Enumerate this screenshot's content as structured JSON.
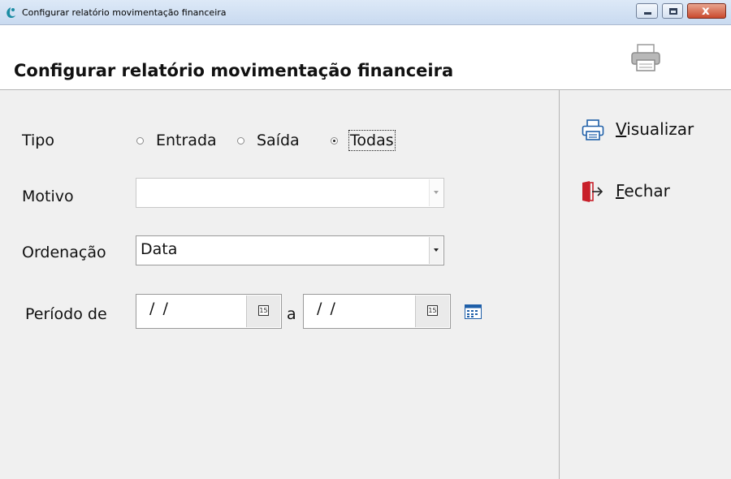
{
  "window": {
    "title": "Configurar relatório movimentação financeira",
    "close_glyph": "x"
  },
  "header": {
    "title": "Configurar relatório movimentação financeira",
    "print_icon": "printer-icon"
  },
  "form": {
    "tipo": {
      "label": "Tipo",
      "options": [
        "Entrada",
        "Saída",
        "Todas"
      ],
      "selected": "Todas"
    },
    "motivo": {
      "label": "Motivo",
      "value": "",
      "enabled": false
    },
    "ordenacao": {
      "label": "Ordenação",
      "value": "Data"
    },
    "periodo": {
      "label": "Período de",
      "separator": "a",
      "start": "/ /",
      "end": "/ /",
      "calendar_btn_text": "15"
    }
  },
  "actions": {
    "visualizar": {
      "label": "isualizar",
      "accel": "V",
      "icon": "printer-icon"
    },
    "fechar": {
      "label": "echar",
      "accel": "F",
      "icon": "exit-door-icon"
    }
  },
  "colors": {
    "accent_blue": "#1f5fa8",
    "exit_red": "#c8202a",
    "app_icon_teal": "#1b8ca3"
  }
}
